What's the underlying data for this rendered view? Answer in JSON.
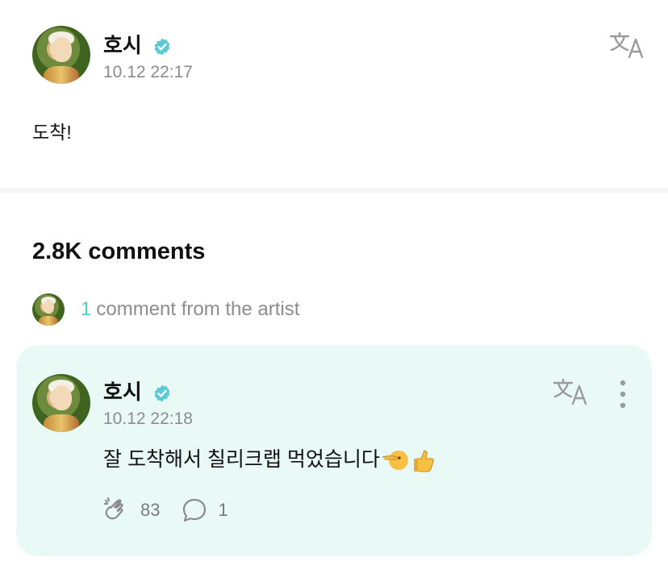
{
  "post": {
    "author": "호시",
    "timestamp": "10.12 22:17",
    "body": "도착!"
  },
  "comments": {
    "count_label": "2.8K comments",
    "artist_comment_count": "1",
    "artist_comment_label": "comment from the artist"
  },
  "artist_comment": {
    "author": "호시",
    "timestamp": "10.12 22:18",
    "text": "잘 도착해서 칠리크랩 먹었습니다",
    "emojis": [
      "hand-pointing-left-face",
      "thumbs-up"
    ],
    "likes": "83",
    "replies": "1"
  },
  "icons": {
    "verified": "verified-badge-icon",
    "translate": "translate-icon",
    "more": "more-vertical-icon",
    "like": "clap-icon",
    "reply": "comment-bubble-icon"
  },
  "colors": {
    "accent": "#55c9c9",
    "card_background": "#e9faf6",
    "muted_text": "#8b8b8b"
  }
}
